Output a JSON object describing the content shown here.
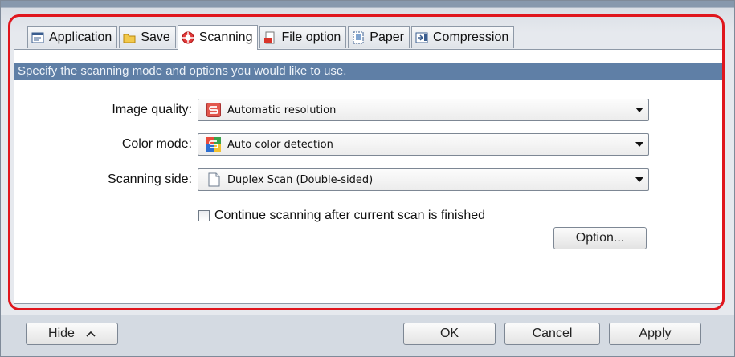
{
  "tabs": [
    {
      "label": "Application",
      "icon": "application-icon"
    },
    {
      "label": "Save",
      "icon": "folder-icon"
    },
    {
      "label": "Scanning",
      "icon": "scanning-icon"
    },
    {
      "label": "File option",
      "icon": "file-option-icon"
    },
    {
      "label": "Paper",
      "icon": "paper-icon"
    },
    {
      "label": "Compression",
      "icon": "compression-icon"
    }
  ],
  "active_tab": "Scanning",
  "banner": "Specify the scanning mode and options you would like to use.",
  "settings": {
    "image_quality": {
      "label": "Image quality:",
      "value": "Automatic resolution"
    },
    "color_mode": {
      "label": "Color mode:",
      "value": "Auto color detection"
    },
    "scanning_side": {
      "label": "Scanning side:",
      "value": "Duplex Scan (Double-sided)"
    }
  },
  "continue_scanning": {
    "label": "Continue scanning after current scan is finished",
    "checked": false
  },
  "buttons": {
    "option": "Option...",
    "hide": "Hide",
    "ok": "OK",
    "cancel": "Cancel",
    "apply": "Apply"
  },
  "colors": {
    "highlight_frame": "#e0161d",
    "banner": "#5f7fa6"
  }
}
